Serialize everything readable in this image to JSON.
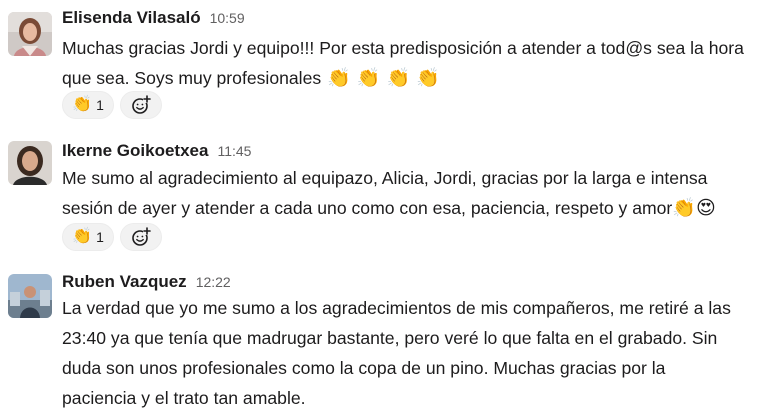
{
  "messages": [
    {
      "author": "Elisenda Vilasaló",
      "time": "10:59",
      "text_lines": [
        "Muchas gracias Jordi y equipo!!! Por esta predisposición a atender a tod@s sea la hora",
        "que sea. Soys muy profesionales"
      ],
      "trailing_emoji": [
        "👏",
        "👏",
        "👏",
        "👏"
      ],
      "reaction": {
        "emoji": "👏",
        "count": "1"
      },
      "add_reaction_icon": "add-reaction-icon"
    },
    {
      "author": "Ikerne Goikoetxea",
      "time": "11:45",
      "text_lines": [
        "Me sumo al agradecimiento al equipazo, Alicia, Jordi, gracias por la larga e intensa",
        "sesión de ayer y atender a cada uno como con esa, paciencia, respeto y amor"
      ],
      "trailing_emoji": [
        "👏",
        "😍"
      ],
      "reaction": {
        "emoji": "👏",
        "count": "1"
      },
      "add_reaction_icon": "add-reaction-icon"
    },
    {
      "author": "Ruben Vazquez",
      "time": "12:22",
      "text_lines": [
        "La verdad que yo me sumo a los agradecimientos de mis compañeros, me retiré a las",
        "23:40 ya que tenía que madrugar bastante, pero veré lo que falta en el grabado. Sin",
        "duda son unos profesionales como la copa de un pino. Muchas gracias por la",
        "paciencia y el trato tan amable."
      ]
    }
  ]
}
